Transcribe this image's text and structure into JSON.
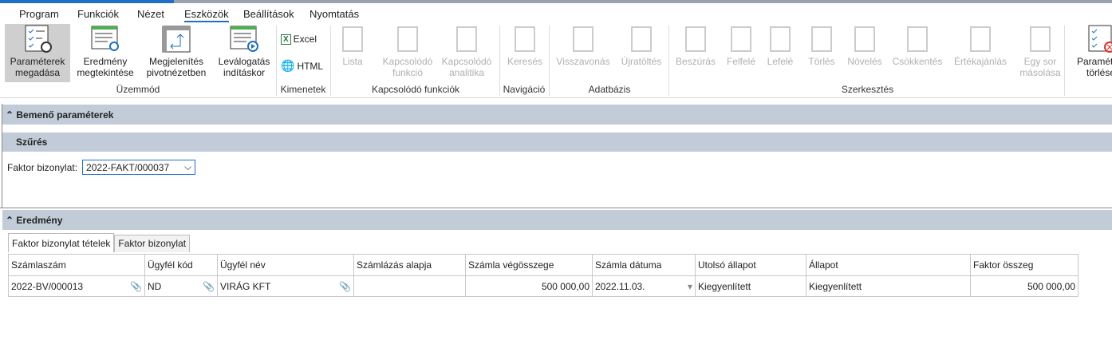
{
  "menu": [
    "Program",
    "Funkciók",
    "Nézet",
    "Eszközök",
    "Beállítások",
    "Nyomtatás"
  ],
  "menu_active": "Eszközök",
  "ribbon": {
    "uzemmod": {
      "label": "Üzemmód",
      "buttons": [
        "Paraméterek megadása",
        "Eredmény megtekintése",
        "Megjelenítés pivotnézetben",
        "Leválogatás indításkor"
      ]
    },
    "kimenetek": {
      "label": "Kimenetek",
      "buttons": [
        "Excel",
        "HTML"
      ]
    },
    "kapcsolodo": {
      "label": "Kapcsolódó funkciók",
      "buttons": [
        "Lista",
        "Kapcsolódó funkció",
        "Kapcsolódó analitika"
      ]
    },
    "navigacio": {
      "label": "Navigáció",
      "buttons": [
        "Keresés"
      ]
    },
    "adatbazis": {
      "label": "Adatbázis",
      "buttons": [
        "Visszavonás",
        "Újratöltés"
      ]
    },
    "szerkesztes": {
      "label": "Szerkesztés",
      "buttons": [
        "Beszúrás",
        "Felfelé",
        "Lefelé",
        "Törlés",
        "Növelés",
        "Csökkentés",
        "Értékajánlás",
        "Egy sor másolása"
      ]
    },
    "extra": "Paraméterek törlése"
  },
  "sections": {
    "input": "Bemenő paraméterek",
    "filter": "Szűrés",
    "result": "Eredmény"
  },
  "filter": {
    "label": "Faktor bizonylat:",
    "value": "2022-FAKT/000037"
  },
  "tabs": [
    "Faktor bizonylat tételek",
    "Faktor bizonylat"
  ],
  "table": {
    "columns": [
      "Számlaszám",
      "Ügyfél kód",
      "Ügyfél név",
      "Számlázás alapja",
      "Számla végösszege",
      "Számla dátuma",
      "Utolsó állapot",
      "Állapot",
      "Faktor összeg"
    ],
    "rows": [
      [
        "2022-BV/000013",
        "ND",
        "VIRÁG KFT",
        "",
        "500 000,00",
        "2022.11.03.",
        "Kiegyenlített",
        "Kiegyenlített",
        "500 000,00"
      ]
    ]
  },
  "colors": {
    "accent": "#1f6fc4",
    "section_bar": "#c1ccd8"
  }
}
